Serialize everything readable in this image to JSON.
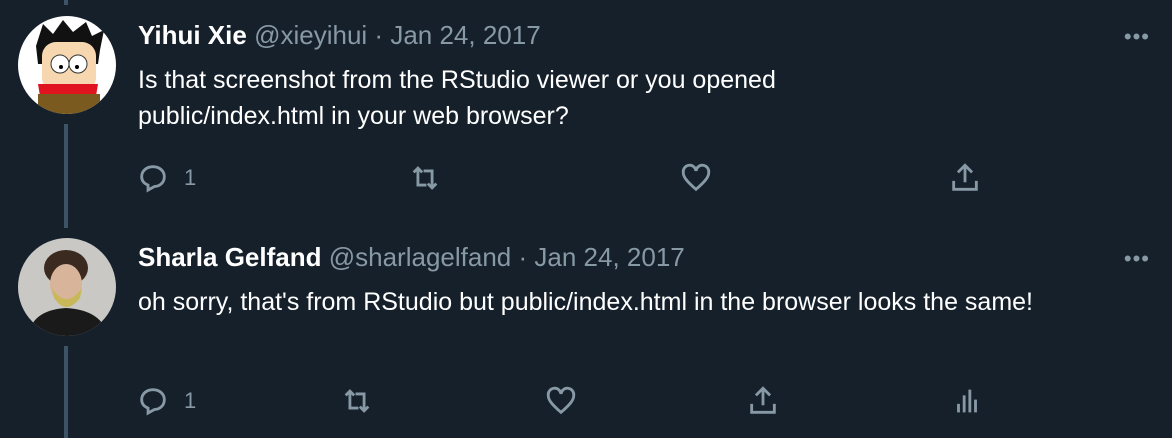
{
  "tweets": [
    {
      "name": "Yihui Xie",
      "handle": "@xieyihui",
      "sep": "·",
      "date": "Jan 24, 2017",
      "text": "Is that screenshot from the RStudio viewer or you opened public/index.html in your web browser?",
      "reply_count": "1"
    },
    {
      "name": "Sharla Gelfand",
      "handle": "@sharlagelfand",
      "sep": "·",
      "date": "Jan 24, 2017",
      "text": "oh sorry, that's from RStudio but public/index.html in the browser looks the same!",
      "reply_count": "1"
    }
  ],
  "more_label": "•••",
  "colors": {
    "background": "#15202b",
    "muted": "#8899a6",
    "thread_line": "#3d5466"
  }
}
